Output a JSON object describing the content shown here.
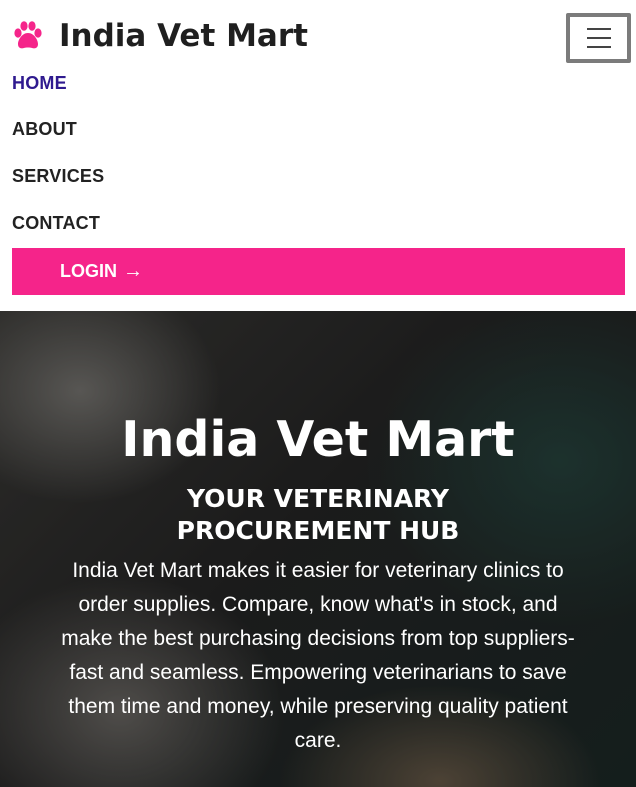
{
  "header": {
    "brand": "India Vet Mart",
    "logo_icon": "paw-icon",
    "menu_icon": "hamburger-menu-icon"
  },
  "nav": {
    "items": [
      {
        "label": "HOME",
        "active": true
      },
      {
        "label": "ABOUT",
        "active": false
      },
      {
        "label": "SERVICES",
        "active": false
      },
      {
        "label": "CONTACT",
        "active": false
      }
    ],
    "login_label": "LOGIN",
    "login_icon": "arrow-right-icon"
  },
  "hero": {
    "title": "India Vet Mart",
    "subtitle": "YOUR VETERINARY PROCUREMENT HUB",
    "description": "India Vet Mart makes it easier for veterinary clinics to order supplies. Compare, know what's in stock, and make the best purchasing decisions from top suppliers-fast and seamless. Empowering veterinarians to save them time and money, while preserving quality patient care."
  },
  "colors": {
    "accent": "#f5248a",
    "nav_active": "#2f1a8f",
    "text": "#212121"
  }
}
